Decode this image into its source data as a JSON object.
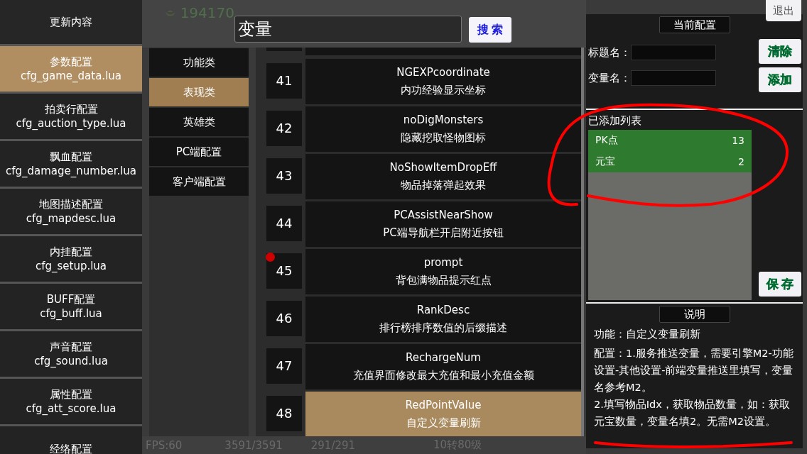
{
  "exit_button": "退出",
  "file_menu": [
    {
      "title": "更新内容",
      "selected": false
    },
    {
      "title": "参数配置",
      "file": "cfg_game_data.lua",
      "selected": true
    },
    {
      "title": "拍卖行配置",
      "file": "cfg_auction_type.lua",
      "selected": false
    },
    {
      "title": "飘血配置",
      "file": "cfg_damage_number.lua",
      "selected": false
    },
    {
      "title": "地图描述配置",
      "file": "cfg_mapdesc.lua",
      "selected": false
    },
    {
      "title": "内挂配置",
      "file": "cfg_setup.lua",
      "selected": false
    },
    {
      "title": "BUFF配置",
      "file": "cfg_buff.lua",
      "selected": false
    },
    {
      "title": "声音配置",
      "file": "cfg_sound.lua",
      "selected": false
    },
    {
      "title": "属性配置",
      "file": "cfg_att_score.lua",
      "selected": false
    },
    {
      "title": "经络配置",
      "selected": false
    }
  ],
  "search": {
    "value": "变量",
    "button": "搜 索"
  },
  "categories": [
    {
      "label": "功能类",
      "selected": false
    },
    {
      "label": "表现类",
      "selected": true
    },
    {
      "label": "英雄类",
      "selected": false
    },
    {
      "label": "PC端配置",
      "selected": false
    },
    {
      "label": "客户端配置",
      "selected": false
    }
  ],
  "variables": [
    {
      "index": "41",
      "name": "NGEXPcoordinate",
      "description": "内功经验显示坐标",
      "selected": false,
      "red_dot": false
    },
    {
      "index": "42",
      "name": "noDigMonsters",
      "description": "隐藏挖取怪物图标",
      "selected": false,
      "red_dot": false
    },
    {
      "index": "43",
      "name": "NoShowItemDropEff",
      "description": "物品掉落弹起效果",
      "selected": false,
      "red_dot": false
    },
    {
      "index": "44",
      "name": "PCAssistNearShow",
      "description": "PC端导航栏开启附近按钮",
      "selected": false,
      "red_dot": false
    },
    {
      "index": "45",
      "name": "prompt",
      "description": "背包满物品提示红点",
      "selected": false,
      "red_dot": true
    },
    {
      "index": "46",
      "name": "RankDesc",
      "description": "排行榜排序数值的后缀描述",
      "selected": false,
      "red_dot": false
    },
    {
      "index": "47",
      "name": "RechargeNum",
      "description": "充值界面修改最大充值和最小充值金额",
      "selected": false,
      "red_dot": false
    },
    {
      "index": "48",
      "name": "RedPointValue",
      "description": "自定义变量刷新",
      "selected": true,
      "red_dot": false
    }
  ],
  "config_panel": {
    "header": "当前配置",
    "fields": [
      {
        "label": "标题名："
      },
      {
        "label": "变量名："
      }
    ],
    "buttons": [
      "清除",
      "添加"
    ],
    "list_title": "已添加列表",
    "added": [
      {
        "name": "PK点",
        "value": "13"
      },
      {
        "name": "元宝",
        "value": "2"
      }
    ],
    "save_button": "保 存"
  },
  "help": {
    "header": "说明",
    "paragraphs": [
      "功能：自定义变量刷新",
      "配置：1.服务推送变量，需要引擎M2-功能设置-其他设置-前端变量推送里填写，变量名参考M2。",
      "2.填写物品Idx，获取物品数量，如：获取元宝数量，变量名填2。无需M2设置。"
    ]
  },
  "hud": {
    "gold": "194170",
    "stats": [
      "FPS:60",
      "3591/3591",
      "291/291",
      "10转80级"
    ]
  },
  "annotations": {
    "circled_list": true,
    "underlined_text": true
  }
}
